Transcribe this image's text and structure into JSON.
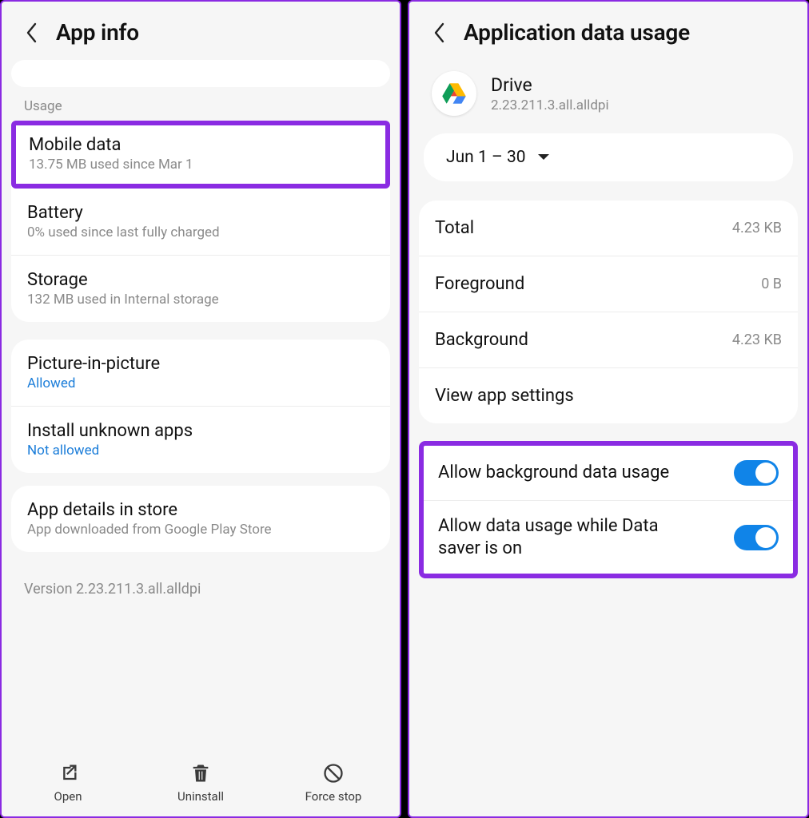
{
  "left": {
    "header_title": "App info",
    "section_usage": "Usage",
    "mobile_data": {
      "title": "Mobile data",
      "sub": "13.75 MB used since Mar 1"
    },
    "battery": {
      "title": "Battery",
      "sub": "0% used since last fully charged"
    },
    "storage": {
      "title": "Storage",
      "sub": "132 MB used in Internal storage"
    },
    "pip": {
      "title": "Picture-in-picture",
      "status": "Allowed"
    },
    "unknown": {
      "title": "Install unknown apps",
      "status": "Not allowed"
    },
    "details": {
      "title": "App details in store",
      "sub": "App downloaded from Google Play Store"
    },
    "version": "Version 2.23.211.3.all.alldpi",
    "buttons": {
      "open": "Open",
      "uninstall": "Uninstall",
      "force_stop": "Force stop"
    }
  },
  "right": {
    "header_title": "Application data usage",
    "app": {
      "name": "Drive",
      "pkg": "2.23.211.3.all.alldpi"
    },
    "date_range": "Jun 1 – 30",
    "usage": {
      "total_label": "Total",
      "total_val": "4.23 KB",
      "fg_label": "Foreground",
      "fg_val": "0 B",
      "bg_label": "Background",
      "bg_val": "4.23 KB",
      "view_settings": "View app settings"
    },
    "toggles": {
      "bg_data": "Allow background data usage",
      "data_saver": "Allow data usage while Data saver is on"
    }
  }
}
